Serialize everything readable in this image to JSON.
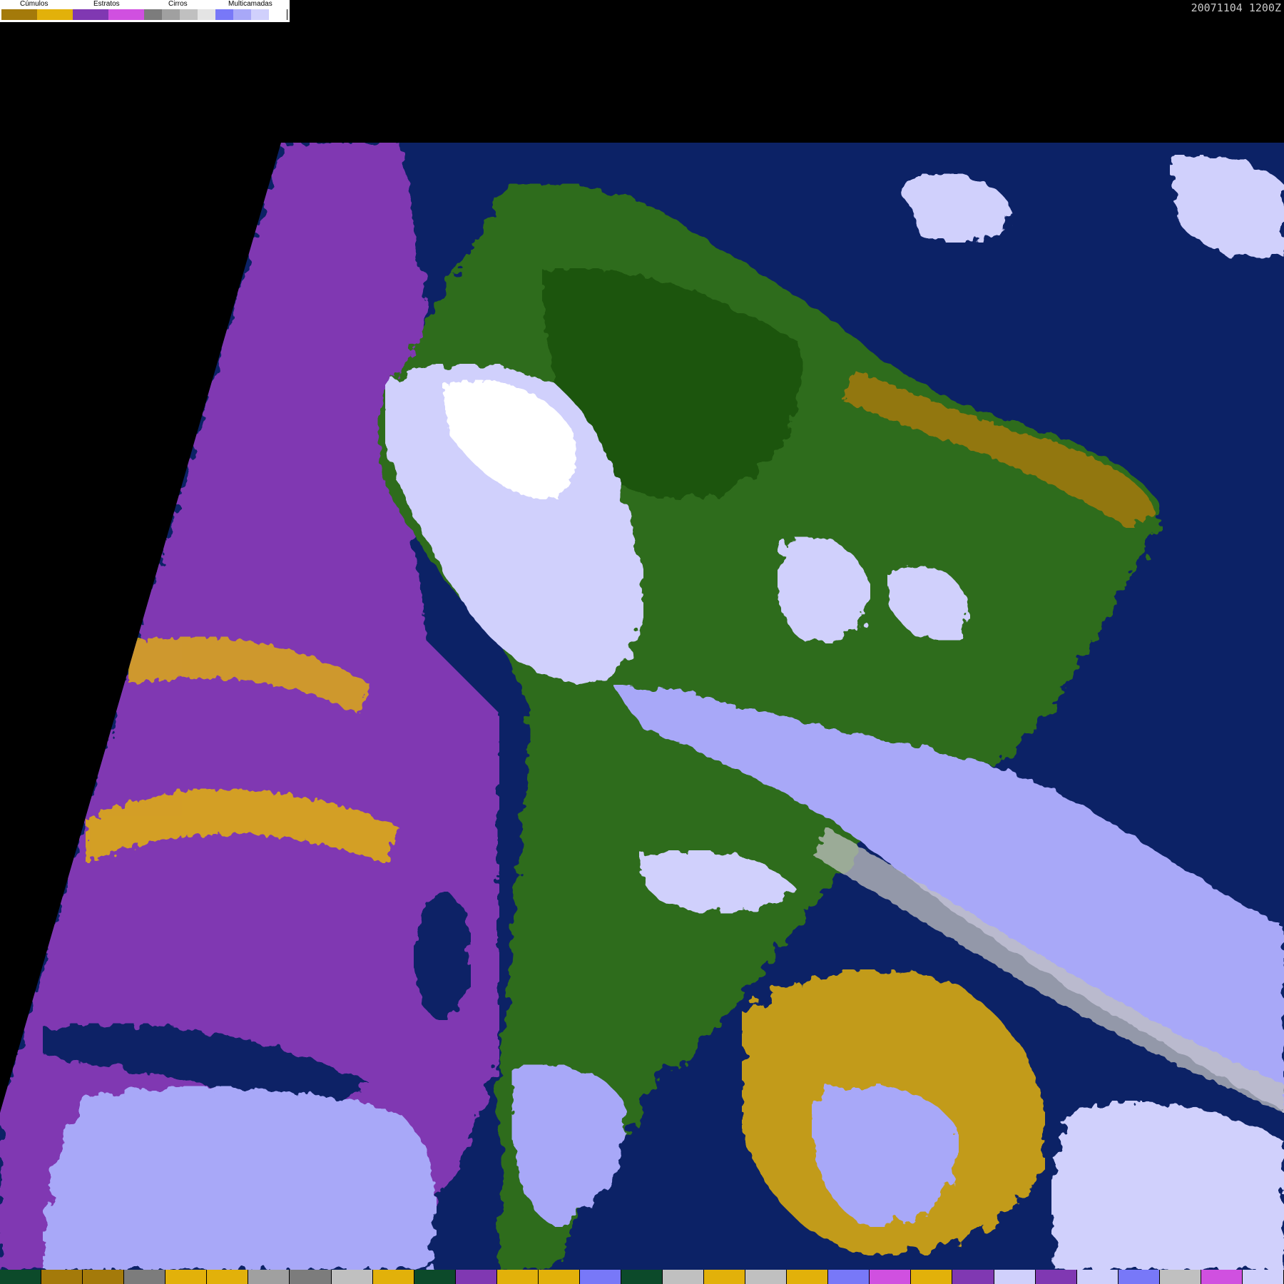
{
  "legend": {
    "groups": [
      {
        "label": "Cúmulos",
        "colors": [
          "#a47a0a",
          "#e2b10a"
        ]
      },
      {
        "label": "Estratos",
        "colors": [
          "#8038b2",
          "#d050e0"
        ]
      },
      {
        "label": "Cirros",
        "colors": [
          "#7c7c7c",
          "#a0a0a0",
          "#c0c0c0",
          "#e4e4e4"
        ]
      },
      {
        "label": "Multicamadas",
        "colors": [
          "#7878f8",
          "#a8a8f8",
          "#d0d0fc",
          "#ffffff"
        ]
      }
    ]
  },
  "timestamp": "20071104 1200Z",
  "map_colors": {
    "ocean": "#0c2266",
    "land": "#2f6c1a",
    "land_dark": "#1f5410",
    "stratus": "#8038b2",
    "stratus_light": "#d050e0",
    "cumulus": "#e2b10a",
    "cumulus_dark": "#a47a0a",
    "cirrus": "#c0c0c0",
    "multilayer": "#a8a8f8",
    "multilayer_light": "#d0d0fc",
    "white": "#ffffff"
  },
  "bottom_bar": [
    "#0c4a2a",
    "#a47a0a",
    "#a47a0a",
    "#7c7c7c",
    "#e2b10a",
    "#e2b10a",
    "#a0a0a0",
    "#7c7c7c",
    "#c0c0c0",
    "#e2b10a",
    "#0c4a2a",
    "#8038b2",
    "#e2b10a",
    "#e2b10a",
    "#7878f8",
    "#0c4a2a",
    "#c0c0c0",
    "#e2b10a",
    "#c0c0c0",
    "#e2b10a",
    "#7878f8",
    "#d050e0",
    "#e2b10a",
    "#8038b2",
    "#d0d0fc",
    "#8038b2",
    "#d0d0fc",
    "#7878f8",
    "#c0c0c0",
    "#d050e0",
    "#d0d0fc"
  ]
}
